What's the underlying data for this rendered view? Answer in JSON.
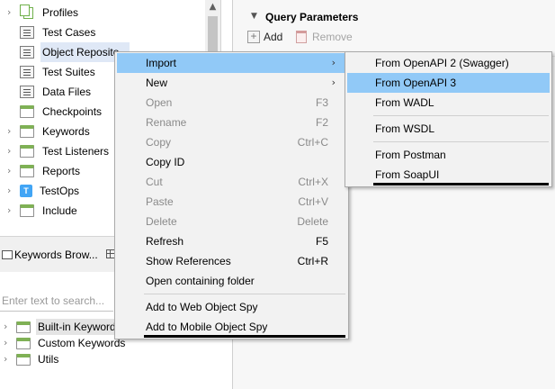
{
  "explorer": {
    "items": [
      {
        "label": "Profiles",
        "expandable": true,
        "icon": "profiles-icon"
      },
      {
        "label": "Test Cases",
        "expandable": false,
        "icon": "test-cases-icon"
      },
      {
        "label": "Object Reposito",
        "expandable": false,
        "icon": "object-repository-icon",
        "selected": true
      },
      {
        "label": "Test Suites",
        "expandable": false,
        "icon": "test-suites-icon"
      },
      {
        "label": "Data Files",
        "expandable": false,
        "icon": "data-files-icon"
      },
      {
        "label": "Checkpoints",
        "expandable": false,
        "icon": "checkpoints-icon"
      },
      {
        "label": "Keywords",
        "expandable": true,
        "icon": "folder-icon"
      },
      {
        "label": "Test Listeners",
        "expandable": true,
        "icon": "folder-icon"
      },
      {
        "label": "Reports",
        "expandable": true,
        "icon": "folder-icon"
      },
      {
        "label": "TestOps",
        "expandable": true,
        "icon": "testops-icon"
      },
      {
        "label": "Include",
        "expandable": true,
        "icon": "folder-icon"
      }
    ]
  },
  "keywords_browser": {
    "tab_label": "Keywords Brow...",
    "search_placeholder": "Enter text to search...",
    "items": [
      {
        "label": "Built-in Keywords",
        "selected": true
      },
      {
        "label": "Custom Keywords",
        "selected": false
      },
      {
        "label": "Utils",
        "selected": false
      }
    ]
  },
  "right_panel": {
    "section_title": "Query Parameters",
    "add_label": "Add",
    "remove_label": "Remove"
  },
  "context_menu": {
    "items": [
      {
        "label": "Import",
        "shortcut": "",
        "submenu": true,
        "disabled": false,
        "highlighted": true
      },
      {
        "label": "New",
        "shortcut": "",
        "submenu": true,
        "disabled": false
      },
      {
        "label": "Open",
        "shortcut": "F3",
        "disabled": true
      },
      {
        "label": "Rename",
        "shortcut": "F2",
        "disabled": true
      },
      {
        "label": "Copy",
        "shortcut": "Ctrl+C",
        "disabled": true
      },
      {
        "label": "Copy ID",
        "shortcut": "",
        "disabled": false
      },
      {
        "label": "Cut",
        "shortcut": "Ctrl+X",
        "disabled": true
      },
      {
        "label": "Paste",
        "shortcut": "Ctrl+V",
        "disabled": true
      },
      {
        "label": "Delete",
        "shortcut": "Delete",
        "disabled": true
      },
      {
        "label": "Refresh",
        "shortcut": "F5",
        "disabled": false
      },
      {
        "label": "Show References",
        "shortcut": "Ctrl+R",
        "disabled": false
      },
      {
        "label": "Open containing folder",
        "shortcut": "",
        "disabled": false
      },
      {
        "label": "Add to Web Object Spy",
        "shortcut": "",
        "disabled": false
      },
      {
        "label": "Add to Mobile Object Spy",
        "shortcut": "",
        "disabled": false
      }
    ]
  },
  "import_submenu": {
    "items": [
      {
        "label": "From OpenAPI 2 (Swagger)",
        "highlighted": false
      },
      {
        "label": "From OpenAPI 3",
        "highlighted": true
      },
      {
        "label": "From WADL",
        "highlighted": false
      },
      {
        "label": "From WSDL",
        "highlighted": false
      },
      {
        "label": "From Postman",
        "highlighted": false
      },
      {
        "label": "From SoapUI",
        "highlighted": false
      }
    ]
  },
  "colors": {
    "highlight": "#91c9f7",
    "folder_accent": "#7fb155",
    "disabled_text": "#8a8a8a"
  }
}
